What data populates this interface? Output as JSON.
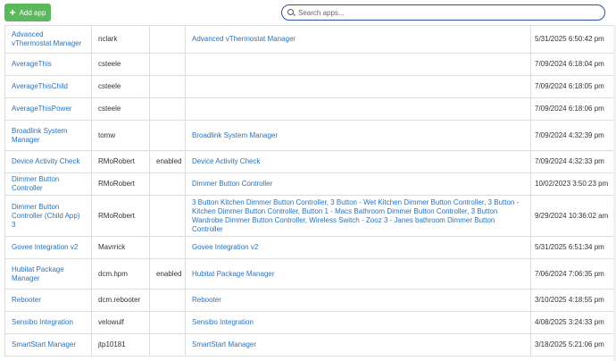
{
  "toolbar": {
    "add_label": "Add app",
    "search_placeholder": "Search apps..."
  },
  "rows": [
    {
      "name": "Advanced vThermostat Manager",
      "author": "nclark",
      "status": "",
      "apps": "Advanced vThermostat Manager",
      "date": "5/31/2025 6:50:42 pm"
    },
    {
      "name": "AverageThis",
      "author": "csteele",
      "status": "",
      "apps": "",
      "date": "7/09/2024 6:18:04 pm"
    },
    {
      "name": "AverageThisChild",
      "author": "csteele",
      "status": "",
      "apps": "",
      "date": "7/09/2024 6:18:05 pm"
    },
    {
      "name": "AverageThisPower",
      "author": "csteele",
      "status": "",
      "apps": "",
      "date": "7/09/2024 6:18:06 pm"
    },
    {
      "name": "Broadlink System Manager",
      "author": "tomw",
      "status": "",
      "apps": "Broadlink System Manager",
      "date": "7/09/2024 4:32:39 pm"
    },
    {
      "name": "Device Activity Check",
      "author": "RMoRobert",
      "status": "enabled",
      "apps": "Device Activity Check",
      "date": "7/09/2024 4:32:33 pm"
    },
    {
      "name": "Dimmer Button Controller",
      "author": "RMoRobert",
      "status": "",
      "apps": "Dimmer Button Controller",
      "date": "10/02/2023 3:50:23 pm"
    },
    {
      "name": "Dimmer Button Controller (Child App) 3",
      "author": "RMoRobert",
      "status": "",
      "apps": "3 Button Kitchen Dimmer Button Controller, 3 Button - Wet Kitchen Dimmer Button Controller, 3 Button - Kitchen Dimmer Button Controller, Button 1 - Macs Bathroom Dimmer Button Controller, 3 Button Wardrobe Dimmer Button Controller, Wireless Switch - Zooz 3 - Janes bathroom Dimmer Button Controller",
      "date": "9/29/2024 10:36:02 am"
    },
    {
      "name": "Govee Integration v2",
      "author": "Mavrrick",
      "status": "",
      "apps": "Govee Integration v2",
      "date": "5/31/2025 6:51:34 pm"
    },
    {
      "name": "Hubitat Package Manager",
      "author": "dcm.hpm",
      "status": "enabled",
      "apps": "Hubitat Package Manager",
      "date": "7/06/2024 7:06:35 pm"
    },
    {
      "name": "Rebooter",
      "author": "dcm.rebooter",
      "status": "",
      "apps": "Rebooter",
      "date": "3/10/2025 4:18:55 pm"
    },
    {
      "name": "Sensibo Integration",
      "author": "velowulf",
      "status": "",
      "apps": "Sensibo Integration",
      "date": "4/08/2025 3:24:33 pm"
    },
    {
      "name": "SmartStart Manager",
      "author": "jtp10181",
      "status": "",
      "apps": "SmartStart Manager",
      "date": "3/18/2025 5:21:06 pm"
    }
  ]
}
